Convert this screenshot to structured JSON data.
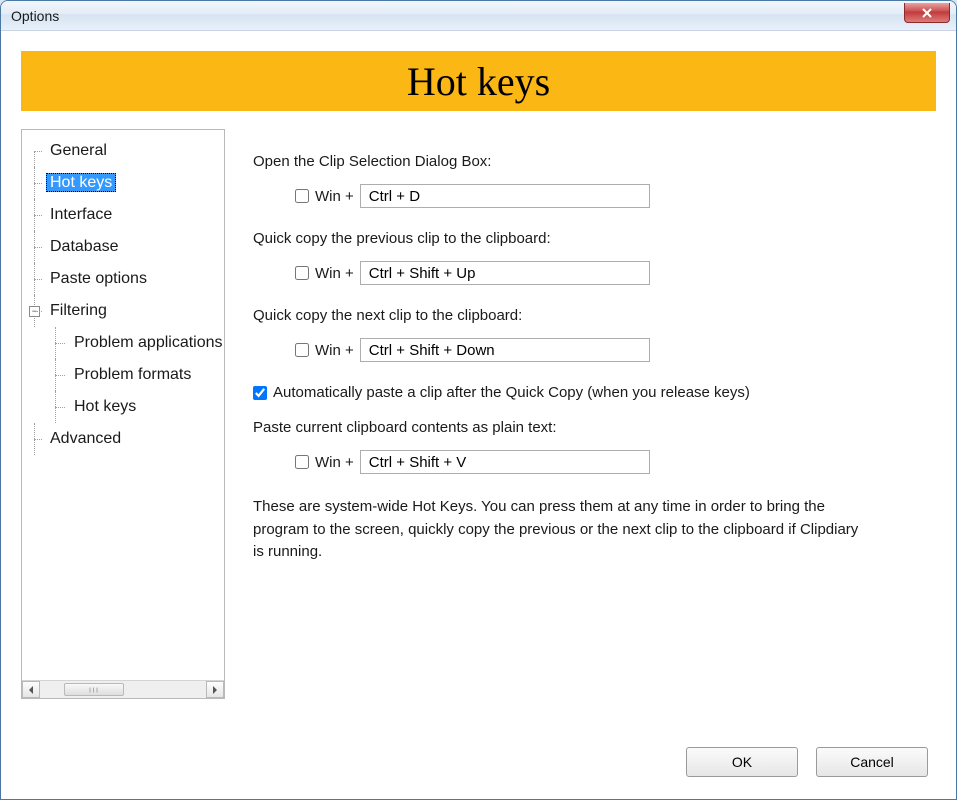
{
  "window": {
    "title": "Options",
    "close_icon": "close-icon"
  },
  "banner": {
    "title": "Hot keys"
  },
  "sidebar": {
    "items": [
      {
        "label": "General",
        "selected": false
      },
      {
        "label": "Hot keys",
        "selected": true
      },
      {
        "label": "Interface",
        "selected": false
      },
      {
        "label": "Database",
        "selected": false
      },
      {
        "label": "Paste options",
        "selected": false
      },
      {
        "label": "Filtering",
        "selected": false,
        "expandable": true,
        "expanded": true
      },
      {
        "label": "Problem applications",
        "selected": false,
        "sub": true
      },
      {
        "label": "Problem formats",
        "selected": false,
        "sub": true
      },
      {
        "label": "Hot keys",
        "selected": false,
        "sub": true
      },
      {
        "label": "Advanced",
        "selected": false
      }
    ],
    "expander_glyph": "−"
  },
  "main": {
    "sections": [
      {
        "label": "Open the Clip Selection Dialog Box:",
        "win_label": "Win +",
        "win_checked": false,
        "value": "Ctrl + D"
      },
      {
        "label": "Quick copy the previous clip to the clipboard:",
        "win_label": "Win +",
        "win_checked": false,
        "value": "Ctrl + Shift + Up"
      },
      {
        "label": "Quick copy the next clip to the clipboard:",
        "win_label": "Win +",
        "win_checked": false,
        "value": "Ctrl + Shift + Down"
      }
    ],
    "auto_paste": {
      "checked": true,
      "label": "Automatically paste a clip after the Quick Copy (when you release keys)"
    },
    "plain_text": {
      "label": "Paste current clipboard contents as plain text:",
      "win_label": "Win +",
      "win_checked": false,
      "value": "Ctrl + Shift + V"
    },
    "note": "These are system-wide Hot Keys. You can press them at any time in order to bring the program to the screen, quickly copy the previous or the next clip to the clipboard if Clipdiary is running."
  },
  "footer": {
    "ok_label": "OK",
    "cancel_label": "Cancel"
  }
}
